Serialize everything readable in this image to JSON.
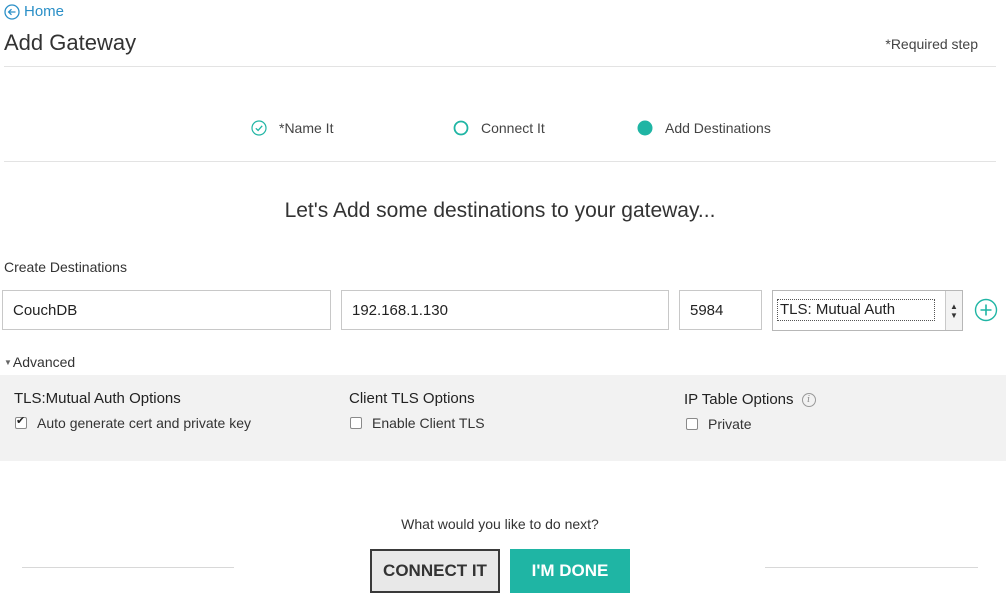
{
  "header": {
    "home_link": "Home",
    "title": "Add Gateway",
    "required_note": "*Required step"
  },
  "steps": [
    {
      "label": "*Name It",
      "state": "completed"
    },
    {
      "label": "Connect It",
      "state": "pending"
    },
    {
      "label": "Add Destinations",
      "state": "active"
    }
  ],
  "headline": "Let's Add some destinations to your gateway...",
  "destinations": {
    "section_label": "Create Destinations",
    "name_value": "CouchDB",
    "host_value": "192.168.1.130",
    "port_value": "5984",
    "security_selected": "TLS: Mutual Auth"
  },
  "advanced": {
    "toggle_label": "Advanced",
    "tls_options": {
      "title": "TLS:Mutual Auth Options",
      "auto_generate_label": "Auto generate cert and private key",
      "auto_generate_checked": true
    },
    "client_tls": {
      "title": "Client TLS Options",
      "enable_label": "Enable Client TLS",
      "enable_checked": false
    },
    "ip_table": {
      "title": "IP Table Options",
      "private_label": "Private",
      "private_checked": false
    }
  },
  "footer": {
    "question": "What would you like to do next?",
    "connect_label": "CONNECT IT",
    "done_label": "I'M DONE"
  },
  "colors": {
    "accent": "#1fb5a4",
    "link": "#2a8fc7"
  },
  "icons": {
    "home": "arrow-left-circle-icon",
    "step_completed": "check-circle-icon",
    "add": "plus-circle-icon",
    "info": "info-icon"
  }
}
